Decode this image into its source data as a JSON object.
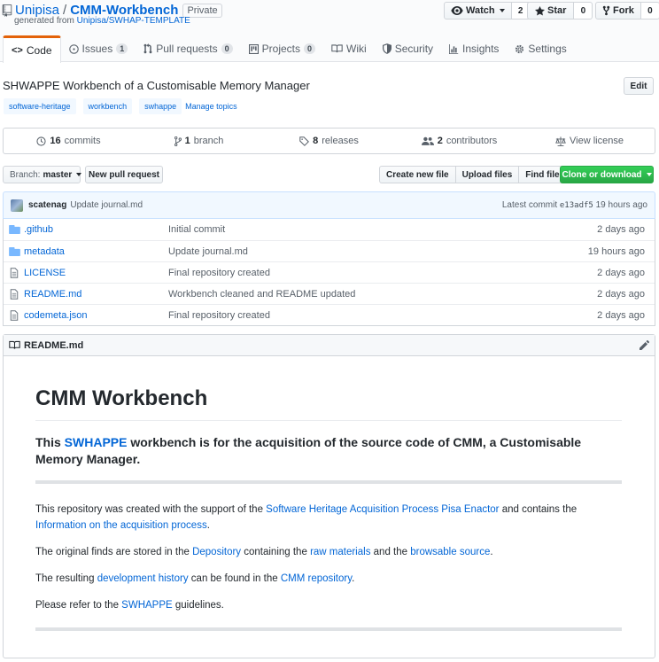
{
  "repo": {
    "owner": "Unipisa",
    "separator": "/",
    "name": "CMM-Workbench",
    "visibility": "Private",
    "generated_prefix": "generated from",
    "generated_from": "Unipisa/SWHAP-TEMPLATE"
  },
  "social": {
    "watch_label": "Watch",
    "watch_count": "2",
    "star_label": "Star",
    "star_count": "0",
    "fork_label": "Fork",
    "fork_count": "0"
  },
  "tabs": [
    {
      "label": "Code",
      "icon": "code-icon"
    },
    {
      "label": "Issues",
      "count": "1",
      "icon": "issue-icon"
    },
    {
      "label": "Pull requests",
      "count": "0",
      "icon": "pull-request-icon"
    },
    {
      "label": "Projects",
      "count": "0",
      "icon": "project-icon"
    },
    {
      "label": "Wiki",
      "icon": "book-icon"
    },
    {
      "label": "Security",
      "icon": "shield-icon"
    },
    {
      "label": "Insights",
      "icon": "graph-icon"
    },
    {
      "label": "Settings",
      "icon": "gear-icon"
    }
  ],
  "description": "SHWAPPE Workbench of a Customisable Memory Manager",
  "edit_label": "Edit",
  "topics": [
    "software-heritage",
    "workbench",
    "swhappe"
  ],
  "manage_topics": "Manage topics",
  "summary": {
    "commits_num": "16",
    "commits_label": "commits",
    "branch_num": "1",
    "branch_label": "branch",
    "releases_num": "8",
    "releases_label": "releases",
    "contributors_num": "2",
    "contributors_label": "contributors",
    "license_label": "View license"
  },
  "file_nav": {
    "branch_prefix": "Branch:",
    "branch_name": "master",
    "new_pr": "New pull request",
    "create_file": "Create new file",
    "upload_files": "Upload files",
    "find_file": "Find file",
    "clone": "Clone or download"
  },
  "latest_commit": {
    "author": "scatenag",
    "message": "Update journal.md",
    "prefix": "Latest commit",
    "sha": "e13adf5",
    "age": "19 hours ago"
  },
  "files": [
    {
      "name": ".github",
      "type": "dir",
      "message": "Initial commit",
      "age": "2 days ago"
    },
    {
      "name": "metadata",
      "type": "dir",
      "message": "Update journal.md",
      "age": "19 hours ago"
    },
    {
      "name": "LICENSE",
      "type": "file",
      "message": "Final repository created",
      "age": "2 days ago"
    },
    {
      "name": "README.md",
      "type": "file",
      "message": "Workbench cleaned and README updated",
      "age": "2 days ago"
    },
    {
      "name": "codemeta.json",
      "type": "file",
      "message": "Final repository created",
      "age": "2 days ago"
    }
  ],
  "readme": {
    "filename": "README.md",
    "h1": "CMM Workbench",
    "h3_pre": "This ",
    "h3_link": "SWHAPPE",
    "h3_post": " workbench is for the acquisition of the source code of CMM, a Customisable Memory Manager.",
    "p1_a": "This repository was created with the support of the ",
    "p1_link1": "Software Heritage Acquisition Process Pisa Enactor",
    "p1_b": " and contains the ",
    "p1_link2": "Information on the acquisition process",
    "p1_c": ".",
    "p2_a": "The original finds are stored in the ",
    "p2_link1": "Depository",
    "p2_b": " containing the ",
    "p2_link2": "raw materials",
    "p2_c": " and the ",
    "p2_link3": "browsable source",
    "p2_d": ".",
    "p3_a": "The resulting ",
    "p3_link1": "development history",
    "p3_b": " can be found in the ",
    "p3_link2": "CMM repository",
    "p3_c": ".",
    "p4_a": "Please refer to the ",
    "p4_link": "SWHAPPE",
    "p4_b": " guidelines."
  },
  "colors": {
    "link": "#0366d6",
    "accent_tab": "#e36209",
    "clone_green": "#28a745"
  }
}
